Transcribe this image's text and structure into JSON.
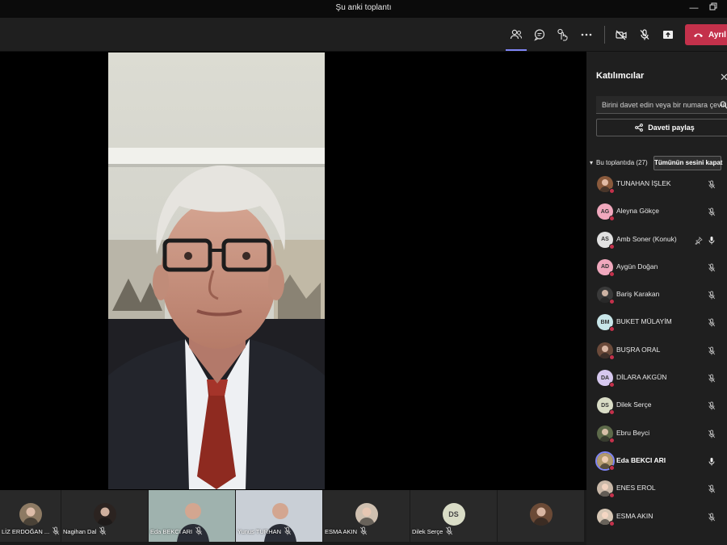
{
  "window": {
    "title": "Şu anki toplantı"
  },
  "toolbar": {
    "leave_label": "Ayrıl"
  },
  "participants_pane": {
    "title": "Katılımcılar",
    "invite_placeholder": "Birini davet edin veya bir numara çevirin",
    "share_label": "Daveti paylaş",
    "section_label": "Bu toplantıda (27)",
    "mute_all_label": "Tümünün sesini kapat",
    "participants": [
      {
        "name": "TUNAHAN İŞLEK",
        "initials": "",
        "avatar_color": "#8a5a3c",
        "mic": "muted"
      },
      {
        "name": "Aleyna Gökçe",
        "initials": "AG",
        "avatar_color": "#f0a8bd",
        "mic": "muted"
      },
      {
        "name": "Amb Soner (Konuk)",
        "initials": "AS",
        "avatar_color": "#e1e1e1",
        "mic": "on",
        "pinned": true
      },
      {
        "name": "Aygün Doğan",
        "initials": "AD",
        "avatar_color": "#f0a8bd",
        "mic": "muted"
      },
      {
        "name": "Bariş Karakan",
        "initials": "",
        "avatar_color": "#3a3a3a",
        "mic": "muted"
      },
      {
        "name": "BUKET MÜLAYİM",
        "initials": "BM",
        "avatar_color": "#c8e6e9",
        "mic": "muted"
      },
      {
        "name": "BUŞRA ORAL",
        "initials": "",
        "avatar_color": "#6b4a3a",
        "mic": "muted"
      },
      {
        "name": "DİLARA AKGÜN",
        "initials": "DA",
        "avatar_color": "#d6c8ef",
        "mic": "muted"
      },
      {
        "name": "Dilek Serçe",
        "initials": "DS",
        "avatar_color": "#d9dcc6",
        "mic": "muted"
      },
      {
        "name": "Ebru Beyci",
        "initials": "",
        "avatar_color": "#5d6a4a",
        "mic": "muted"
      },
      {
        "name": "Eda BEKCI ARI",
        "initials": "",
        "avatar_color": "#b29a6e",
        "mic": "on",
        "speaking": true
      },
      {
        "name": "ENES EROL",
        "initials": "",
        "avatar_color": "#c9b8a8",
        "mic": "muted"
      },
      {
        "name": "ESMA AKIN",
        "initials": "",
        "avatar_color": "#d7c7b5",
        "mic": "muted"
      }
    ]
  },
  "video_strip": [
    {
      "name": "LİZ ERDOĞAN ...",
      "kind": "photo",
      "color": "#8d7a63"
    },
    {
      "name": "Nagihan Dal",
      "kind": "photo",
      "color": "#2b2320"
    },
    {
      "name": "Eda BEKCI ARI",
      "kind": "video",
      "color": "#9fb2ae"
    },
    {
      "name": "Yunus TURHAN",
      "kind": "video",
      "color": "#c9cfd6"
    },
    {
      "name": "ESMA AKIN",
      "kind": "photo",
      "color": "#cfc0b0"
    },
    {
      "name": "Dilek Serçe",
      "kind": "initials",
      "initials": "DS"
    },
    {
      "name": "",
      "kind": "photo",
      "color": "#6b4a36"
    }
  ]
}
